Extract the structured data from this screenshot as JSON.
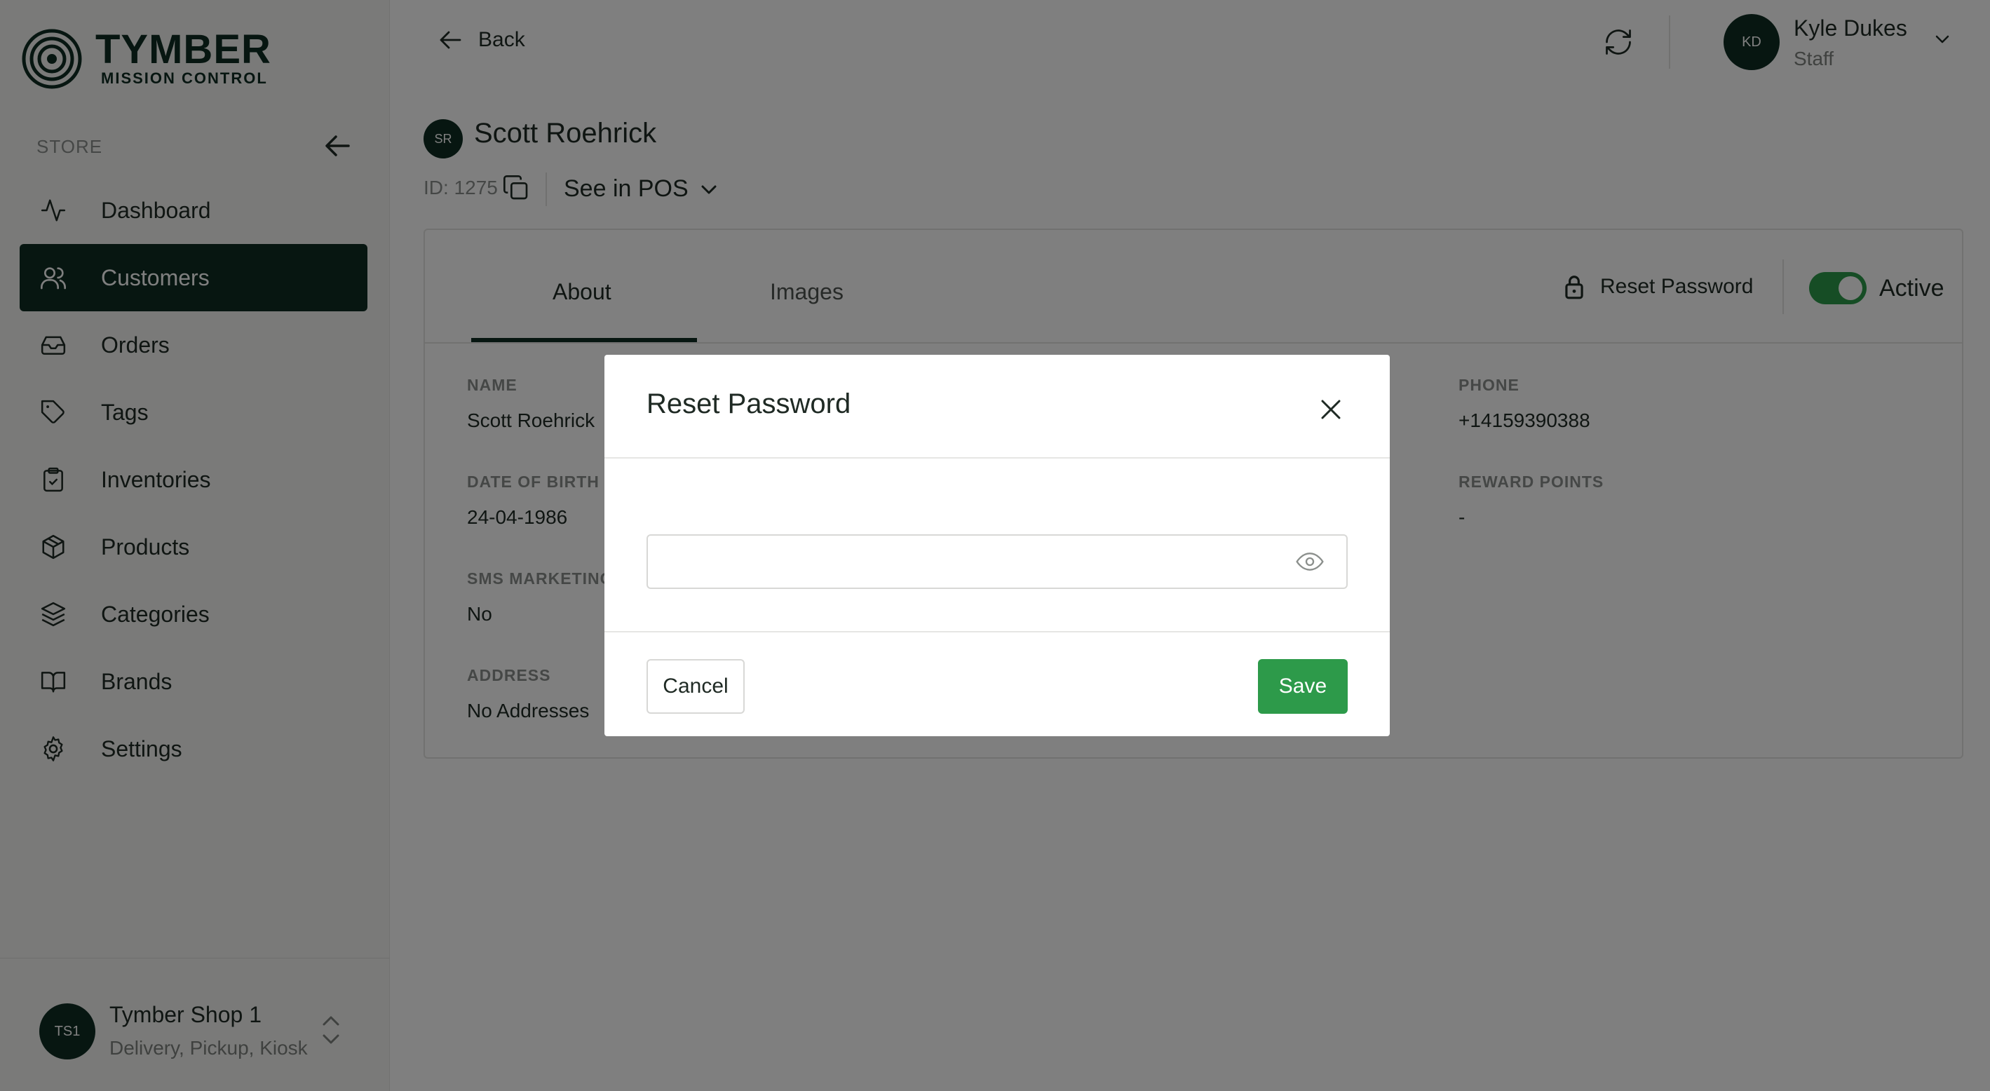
{
  "brand": {
    "title": "TYMBER",
    "subtitle": "MISSION CONTROL"
  },
  "sidebar": {
    "section_label": "STORE",
    "items": [
      {
        "label": "Dashboard",
        "icon": "activity-icon"
      },
      {
        "label": "Customers",
        "icon": "users-icon",
        "active": true
      },
      {
        "label": "Orders",
        "icon": "inbox-icon"
      },
      {
        "label": "Tags",
        "icon": "tag-icon"
      },
      {
        "label": "Inventories",
        "icon": "clipboard-check-icon"
      },
      {
        "label": "Products",
        "icon": "box-icon"
      },
      {
        "label": "Categories",
        "icon": "layers-icon"
      },
      {
        "label": "Brands",
        "icon": "book-icon"
      },
      {
        "label": "Settings",
        "icon": "gear-icon"
      }
    ],
    "shop": {
      "initials": "TS1",
      "name": "Tymber Shop 1",
      "subtitle": "Delivery, Pickup, Kiosk"
    }
  },
  "header": {
    "back_label": "Back",
    "user": {
      "initials": "KD",
      "name": "Kyle Dukes",
      "role": "Staff"
    }
  },
  "customer": {
    "initials": "SR",
    "name": "Scott Roehrick",
    "id_text": "ID: 1275",
    "see_in_pos": "See in POS",
    "tabs": [
      "About",
      "Images"
    ],
    "reset_password_label": "Reset Password",
    "active_label": "Active",
    "fields": {
      "name_label": "NAME",
      "name_value": "Scott Roehrick",
      "dob_label": "DATE OF BIRTH",
      "dob_value": "24-04-1986",
      "sms_label": "SMS MARKETING",
      "sms_value": "No",
      "address_label": "ADDRESS",
      "address_value": "No Addresses",
      "phone_label": "PHONE",
      "phone_value": "+14159390388",
      "reward_label": "REWARD POINTS",
      "reward_value": "-"
    }
  },
  "modal": {
    "title": "Reset Password",
    "input_value": "",
    "cancel_label": "Cancel",
    "save_label": "Save"
  },
  "colors": {
    "brand_dark": "#0e2d22",
    "accent_green": "#2d9a4a"
  }
}
